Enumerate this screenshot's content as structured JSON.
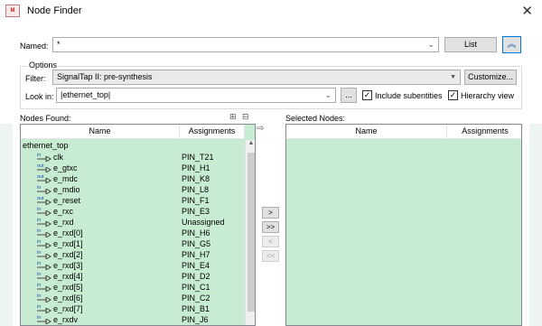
{
  "window": {
    "title": "Node Finder",
    "app_icon": "quartus-icon",
    "close_glyph": "✕"
  },
  "named": {
    "label": "Named:",
    "value": "*"
  },
  "list_button": "List",
  "options": {
    "group_label": "Options",
    "filter_label": "Filter:",
    "filter_value": "SignalTap II: pre-synthesis",
    "customize_button": "Customize...",
    "lookin_label": "Look in:",
    "lookin_value": "|ethernet_top|",
    "browse_button": "...",
    "include_subentities": {
      "label": "Include subentities",
      "checked": true
    },
    "hierarchy_view": {
      "label": "Hierarchy view",
      "checked": true
    }
  },
  "nodes_found": {
    "label": "Nodes Found:",
    "columns": [
      "Name",
      "Assignments"
    ],
    "root": "ethernet_top",
    "rows": [
      {
        "name": "clk",
        "assignment": "PIN_T21",
        "dir": "in"
      },
      {
        "name": "e_gtxc",
        "assignment": "PIN_H1",
        "dir": "out"
      },
      {
        "name": "e_mdc",
        "assignment": "PIN_K8",
        "dir": "out"
      },
      {
        "name": "e_mdio",
        "assignment": "PIN_L8",
        "dir": "io"
      },
      {
        "name": "e_reset",
        "assignment": "PIN_F1",
        "dir": "out"
      },
      {
        "name": "e_rxc",
        "assignment": "PIN_E3",
        "dir": "in"
      },
      {
        "name": "e_rxd",
        "assignment": "Unassigned",
        "dir": "in"
      },
      {
        "name": "e_rxd[0]",
        "assignment": "PIN_H6",
        "dir": "in"
      },
      {
        "name": "e_rxd[1]",
        "assignment": "PIN_G5",
        "dir": "in"
      },
      {
        "name": "e_rxd[2]",
        "assignment": "PIN_H7",
        "dir": "in"
      },
      {
        "name": "e_rxd[3]",
        "assignment": "PIN_E4",
        "dir": "in"
      },
      {
        "name": "e_rxd[4]",
        "assignment": "PIN_D2",
        "dir": "in"
      },
      {
        "name": "e_rxd[5]",
        "assignment": "PIN_C1",
        "dir": "in"
      },
      {
        "name": "e_rxd[6]",
        "assignment": "PIN_C2",
        "dir": "in"
      },
      {
        "name": "e_rxd[7]",
        "assignment": "PIN_B1",
        "dir": "in"
      },
      {
        "name": "e_rxdv",
        "assignment": "PIN_J6",
        "dir": "in"
      }
    ]
  },
  "selected_nodes": {
    "label": "Selected Nodes:",
    "columns": [
      "Name",
      "Assignments"
    ]
  },
  "move_buttons": {
    "add": ">",
    "add_all": ">>",
    "remove": "<",
    "remove_all": "<<"
  }
}
